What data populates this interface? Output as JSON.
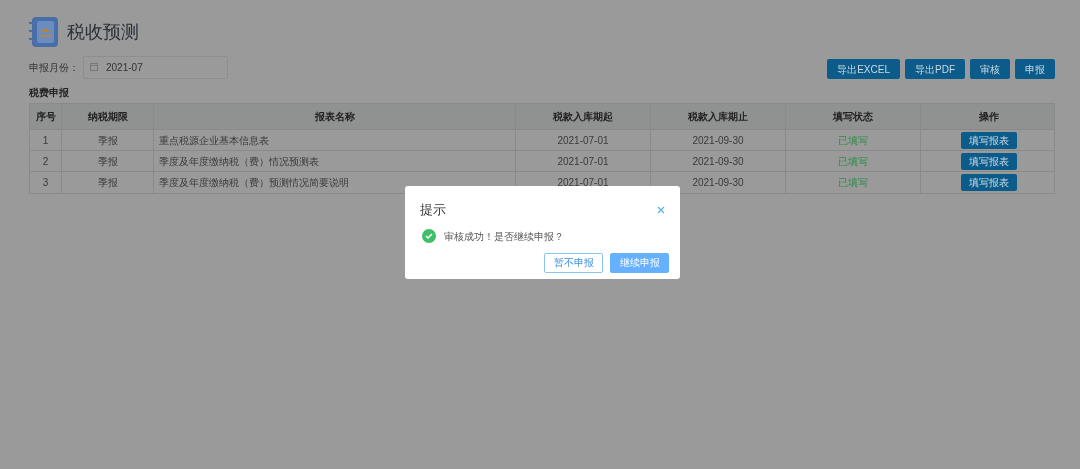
{
  "page": {
    "title": "税收预测"
  },
  "filter": {
    "label": "申报月份：",
    "value": "2021-07"
  },
  "toolbar": [
    "导出EXCEL",
    "导出PDF",
    "审核",
    "申报"
  ],
  "section_title": "税费申报",
  "table": {
    "columns": [
      "序号",
      "纳税期限",
      "报表名称",
      "税款入库期起",
      "税款入库期止",
      "填写状态",
      "操作"
    ],
    "rows": [
      {
        "cells": [
          "1",
          "季报",
          "重点税源企业基本信息表",
          "2021-07-01",
          "2021-09-30",
          "已填写"
        ],
        "action": "填写报表"
      },
      {
        "cells": [
          "2",
          "季报",
          "季度及年度缴纳税（费）情况预测表",
          "2021-07-01",
          "2021-09-30",
          "已填写"
        ],
        "action": "填写报表"
      },
      {
        "cells": [
          "3",
          "季报",
          "季度及年度缴纳税（费）预测情况简要说明",
          "2021-07-01",
          "2021-09-30",
          "已填写"
        ],
        "action": "填写报表"
      }
    ]
  },
  "dialog": {
    "title": "提示",
    "message": "审核成功！是否继续申报？",
    "buttons": [
      {
        "label": "暂不申报",
        "kind": "secondary"
      },
      {
        "label": "继续申报",
        "kind": "primary"
      }
    ]
  }
}
